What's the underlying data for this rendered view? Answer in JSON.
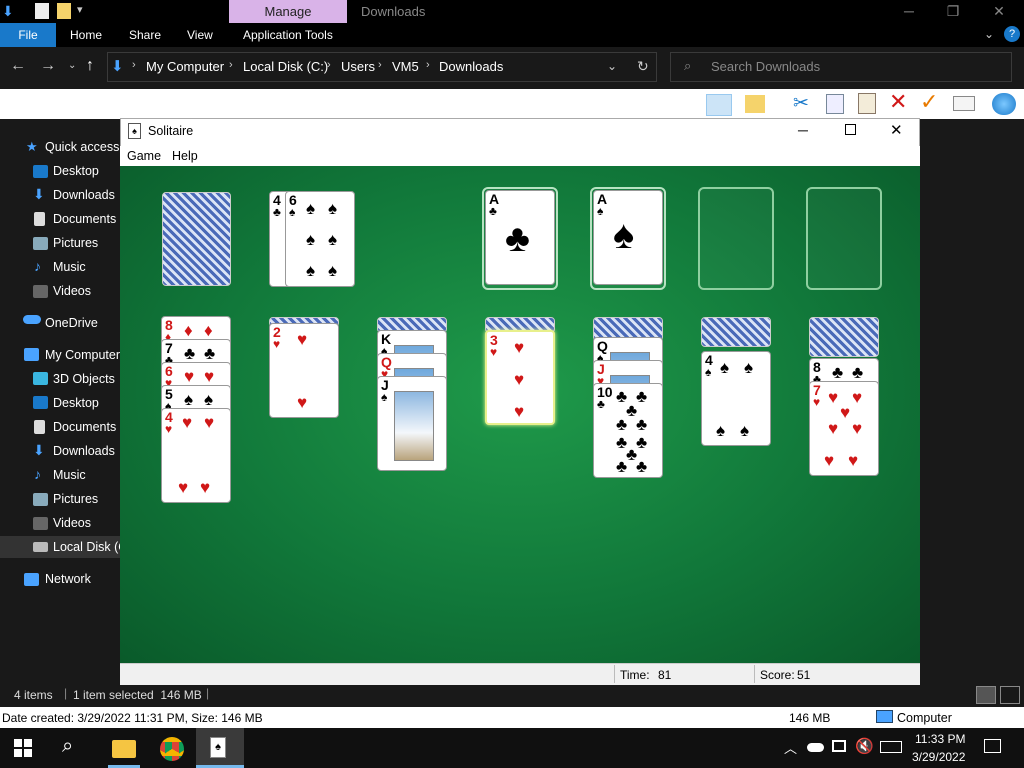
{
  "explorer": {
    "context_tab": "Manage",
    "window_title": "Downloads",
    "tabs": [
      "File",
      "Home",
      "Share",
      "View",
      "Application Tools"
    ],
    "breadcrumb": [
      "My Computer",
      "Local Disk (C:)",
      "Users",
      "VM5",
      "Downloads"
    ],
    "search_placeholder": "Search Downloads",
    "nav_items": [
      "Quick access",
      "Desktop",
      "Downloads",
      "Documents",
      "Pictures",
      "Music",
      "Videos",
      "OneDrive",
      "My Computer",
      "3D Objects",
      "Desktop",
      "Documents",
      "Downloads",
      "Music",
      "Pictures",
      "Videos",
      "Local Disk (C:)",
      "Network"
    ],
    "status_items": "4 items",
    "status_selected": "1 item selected  146 MB",
    "details_text": "Date created: 3/29/2022 11:31 PM, Size: 146 MB",
    "details_size": "146 MB",
    "details_location": "Computer"
  },
  "solitaire": {
    "title": "Solitaire",
    "menu": [
      "Game",
      "Help"
    ],
    "time_label": "Time:",
    "time_value": "81",
    "score_label": "Score:",
    "score_value": "51",
    "waste": [
      {
        "rank": "4",
        "suit": "♣"
      },
      {
        "rank": "6",
        "suit": "♠"
      }
    ],
    "foundations": [
      {
        "rank": "A",
        "suit": "♣"
      },
      {
        "rank": "A",
        "suit": "♠"
      }
    ],
    "tableau": [
      {
        "hidden": 0,
        "cards": [
          {
            "rank": "8",
            "suit": "♦"
          },
          {
            "rank": "7",
            "suit": "♣"
          },
          {
            "rank": "6",
            "suit": "♥"
          },
          {
            "rank": "5",
            "suit": "♠"
          },
          {
            "rank": "4",
            "suit": "♥"
          }
        ]
      },
      {
        "hidden": 1,
        "cards": [
          {
            "rank": "2",
            "suit": "♥"
          }
        ]
      },
      {
        "hidden": 2,
        "cards": [
          {
            "rank": "K",
            "suit": "♠"
          },
          {
            "rank": "Q",
            "suit": "♥"
          },
          {
            "rank": "J",
            "suit": "♠"
          }
        ]
      },
      {
        "hidden": 3,
        "cards": [
          {
            "rank": "3",
            "suit": "♥"
          }
        ]
      },
      {
        "hidden": 4,
        "cards": [
          {
            "rank": "Q",
            "suit": "♠"
          },
          {
            "rank": "J",
            "suit": "♥"
          },
          {
            "rank": "10",
            "suit": "♣"
          }
        ]
      },
      {
        "hidden": 5,
        "cards": [
          {
            "rank": "4",
            "suit": "♠"
          }
        ]
      },
      {
        "hidden": 6,
        "cards": [
          {
            "rank": "8",
            "suit": "♣"
          },
          {
            "rank": "7",
            "suit": "♥"
          }
        ]
      }
    ]
  },
  "taskbar": {
    "time": "11:33 PM",
    "date": "3/29/2022"
  }
}
